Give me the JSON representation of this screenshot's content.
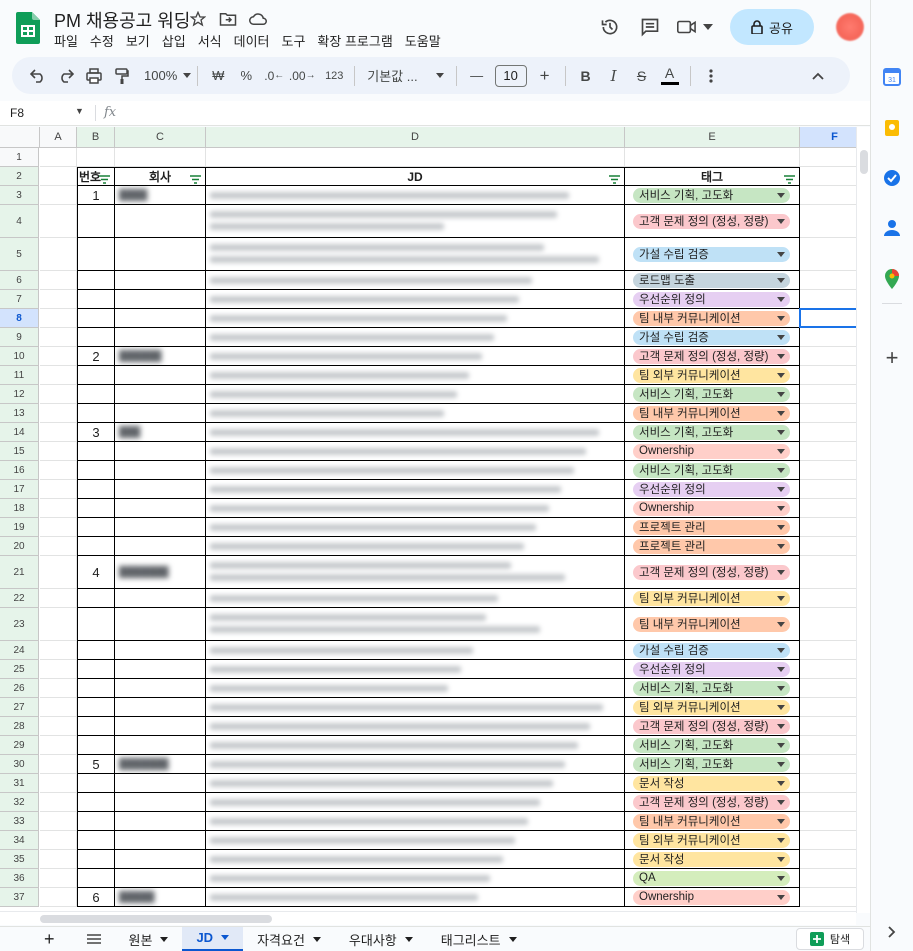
{
  "doc": {
    "title": "PM 채용공고 워딩",
    "menu": [
      "파일",
      "수정",
      "보기",
      "삽입",
      "서식",
      "데이터",
      "도구",
      "확장 프로그램",
      "도움말"
    ],
    "share_label": "공유",
    "avatar_initial": "?"
  },
  "toolbar": {
    "zoom": "100%",
    "currency": "₩",
    "percent": "%",
    "dec_decrease": ".0",
    "dec_increase": ".00",
    "number_format": "123",
    "font": "기본값 ...",
    "font_size": "10",
    "bold": "B",
    "italic": "I",
    "strike": "S",
    "text_color": "A"
  },
  "formula_bar": {
    "cell_ref": "F8",
    "fx": "fx"
  },
  "columns": [
    "A",
    "B",
    "C",
    "D",
    "E",
    "F"
  ],
  "header_row": {
    "number": "번호",
    "company": "회사",
    "jd": "JD",
    "tag": "태그"
  },
  "rows": [
    {
      "n": "1",
      "num": "",
      "company": "",
      "tag": ""
    },
    {
      "n": "2",
      "num": "",
      "company": "",
      "tag": ""
    },
    {
      "n": "3",
      "num": "1",
      "company": "████",
      "tag": "서비스 기획, 고도화"
    },
    {
      "n": "4",
      "num": "",
      "company": "",
      "tag": "고객 문제 정의 (정성, 정량)"
    },
    {
      "n": "5",
      "num": "",
      "company": "",
      "tag": "가설 수립 검증"
    },
    {
      "n": "6",
      "num": "",
      "company": "",
      "tag": "로드맵 도출"
    },
    {
      "n": "7",
      "num": "",
      "company": "",
      "tag": "우선순위 정의"
    },
    {
      "n": "8",
      "num": "",
      "company": "",
      "tag": "팀 내부 커뮤니케이션"
    },
    {
      "n": "9",
      "num": "",
      "company": "",
      "tag": "가설 수립 검증"
    },
    {
      "n": "10",
      "num": "2",
      "company": "██████",
      "tag": "고객 문제 정의 (정성, 정량)"
    },
    {
      "n": "11",
      "num": "",
      "company": "",
      "tag": "팀 외부 커뮤니케이션"
    },
    {
      "n": "12",
      "num": "",
      "company": "",
      "tag": "서비스 기획, 고도화"
    },
    {
      "n": "13",
      "num": "",
      "company": "",
      "tag": "팀 내부 커뮤니케이션"
    },
    {
      "n": "14",
      "num": "3",
      "company": "███",
      "tag": "서비스 기획, 고도화"
    },
    {
      "n": "15",
      "num": "",
      "company": "",
      "tag": "Ownership"
    },
    {
      "n": "16",
      "num": "",
      "company": "",
      "tag": "서비스 기획, 고도화"
    },
    {
      "n": "17",
      "num": "",
      "company": "",
      "tag": "우선순위 정의"
    },
    {
      "n": "18",
      "num": "",
      "company": "",
      "tag": "Ownership"
    },
    {
      "n": "19",
      "num": "",
      "company": "",
      "tag": "프로젝트 관리"
    },
    {
      "n": "20",
      "num": "",
      "company": "",
      "tag": "프로젝트 관리"
    },
    {
      "n": "21",
      "num": "4",
      "company": "███████",
      "tag": "고객 문제 정의 (정성, 정량)"
    },
    {
      "n": "22",
      "num": "",
      "company": "",
      "tag": "팀 외부 커뮤니케이션"
    },
    {
      "n": "23",
      "num": "",
      "company": "",
      "tag": "팀 내부 커뮤니케이션"
    },
    {
      "n": "24",
      "num": "",
      "company": "",
      "tag": "가설 수립 검증"
    },
    {
      "n": "25",
      "num": "",
      "company": "",
      "tag": "우선순위 정의"
    },
    {
      "n": "26",
      "num": "",
      "company": "",
      "tag": "서비스 기획, 고도화"
    },
    {
      "n": "27",
      "num": "",
      "company": "",
      "tag": "팀 외부 커뮤니케이션"
    },
    {
      "n": "28",
      "num": "",
      "company": "",
      "tag": "고객 문제 정의 (정성, 정량)"
    },
    {
      "n": "29",
      "num": "",
      "company": "",
      "tag": "서비스 기획, 고도화"
    },
    {
      "n": "30",
      "num": "5",
      "company": "███████",
      "tag": "서비스 기획, 고도화"
    },
    {
      "n": "31",
      "num": "",
      "company": "",
      "tag": "문서 작성"
    },
    {
      "n": "32",
      "num": "",
      "company": "",
      "tag": "고객 문제 정의 (정성, 정량)"
    },
    {
      "n": "33",
      "num": "",
      "company": "",
      "tag": "팀 내부 커뮤니케이션"
    },
    {
      "n": "34",
      "num": "",
      "company": "",
      "tag": "팀 외부 커뮤니케이션"
    },
    {
      "n": "35",
      "num": "",
      "company": "",
      "tag": "문서 작성"
    },
    {
      "n": "36",
      "num": "",
      "company": "",
      "tag": "QA"
    },
    {
      "n": "37",
      "num": "6",
      "company": "█████",
      "tag": "Ownership"
    }
  ],
  "tag_colors": {
    "서비스 기획, 고도화": "#c6e6c3",
    "고객 문제 정의 (정성, 정량)": "#fbc8cc",
    "가설 수립 검증": "#bfe1f6",
    "로드맵 도출": "#c5d5de",
    "우선순위 정의": "#e6cff2",
    "팀 내부 커뮤니케이션": "#ffc8aa",
    "팀 외부 커뮤니케이션": "#ffe5a0",
    "Ownership": "#ffcfc9",
    "프로젝트 관리": "#ffc8aa",
    "문서 작성": "#ffe5a0",
    "QA": "#d4edbc"
  },
  "sheets": [
    "원본",
    "JD",
    "자격요건",
    "우대사항",
    "태그리스트"
  ],
  "active_sheet": "JD",
  "explore_label": "탐색",
  "colors": {
    "accent": "#0b57d0",
    "share_bg": "#c2e7ff",
    "header_green": "#e6f4ea",
    "sheets_green": "#0f9d58"
  }
}
